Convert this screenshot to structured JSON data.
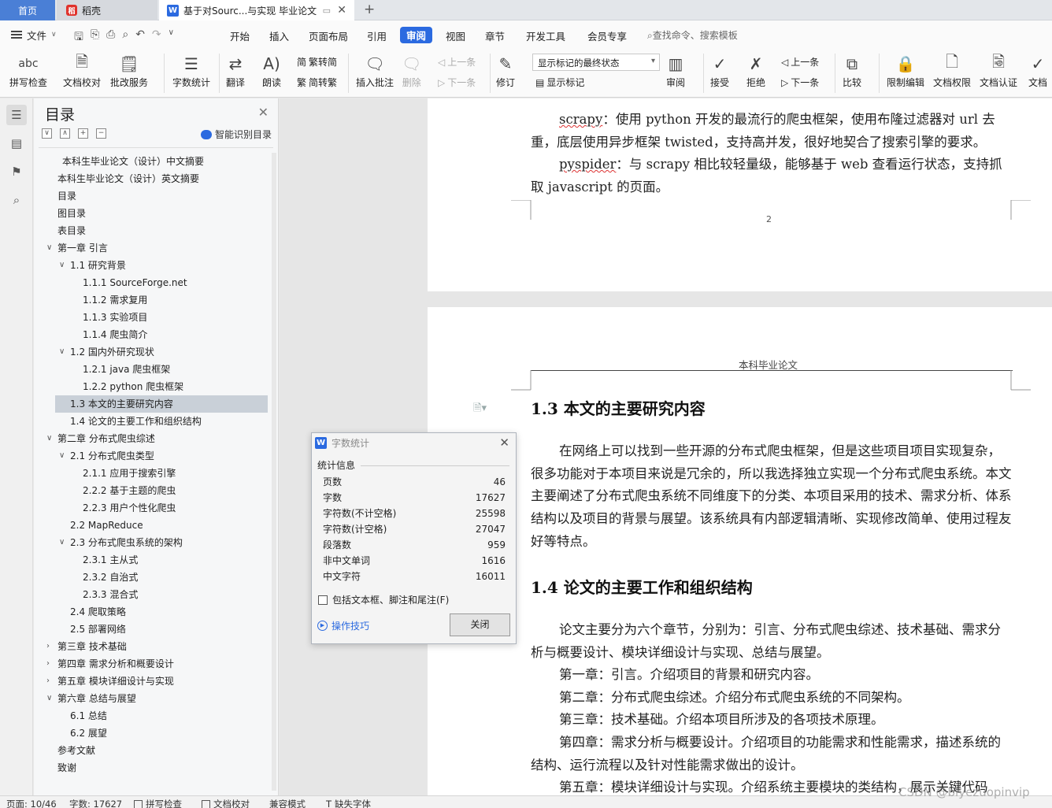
{
  "tabs": {
    "home": "首页",
    "daoke": "稻壳",
    "doc": "基于对Sourc...与实现 毕业论文"
  },
  "menu": {
    "file": "文件",
    "items": [
      "开始",
      "插入",
      "页面布局",
      "引用",
      "审阅",
      "视图",
      "章节",
      "开发工具",
      "会员专享"
    ],
    "active": "审阅",
    "search": "查找命令、搜索模板"
  },
  "toolbar": {
    "spell": "拼写检查",
    "doc_check": "文档校对",
    "batch": "批改服务",
    "word_count": "字数统计",
    "translate": "翻译",
    "read_aloud": "朗读",
    "trad": "繁转简",
    "simp": "简转繁",
    "insert_comment": "插入批注",
    "delete": "删除",
    "prev": "上一条",
    "next": "下一条",
    "revise": "修订",
    "markup_select": "显示标记的最终状态",
    "show_markup": "显示标记",
    "review": "审阅",
    "accept": "接受",
    "reject": "拒绝",
    "prev2": "上一条",
    "next2": "下一条",
    "compare": "比较",
    "restrict": "限制编辑",
    "permission": "文档权限",
    "auth": "文档认证",
    "more": "文档"
  },
  "toc": {
    "title": "目录",
    "smart": "智能识别目录",
    "items": [
      {
        "text": "本科生毕业论文（设计）中文摘要",
        "level": 0
      },
      {
        "text": "本科生毕业论文（设计）英文摘要",
        "level": 0
      },
      {
        "text": "目录",
        "level": 0
      },
      {
        "text": "图目录",
        "level": 0
      },
      {
        "text": "表目录",
        "level": 0
      },
      {
        "text": "第一章  引言",
        "level": 0,
        "arrow": "v"
      },
      {
        "text": "1.1  研究背景",
        "level": 1,
        "arrow": "v"
      },
      {
        "text": "1.1.1 SourceForge.net",
        "level": 2
      },
      {
        "text": "1.1.2  需求复用",
        "level": 2
      },
      {
        "text": "1.1.3  实验项目",
        "level": 2
      },
      {
        "text": "1.1.4  爬虫简介",
        "level": 2
      },
      {
        "text": "1.2  国内外研究现状",
        "level": 1,
        "arrow": "v"
      },
      {
        "text": "1.2.1 java 爬虫框架",
        "level": 2
      },
      {
        "text": "1.2.2 python 爬虫框架",
        "level": 2
      },
      {
        "text": "1.3  本文的主要研究内容",
        "level": 1,
        "selected": true
      },
      {
        "text": "1.4  论文的主要工作和组织结构",
        "level": 1
      },
      {
        "text": "第二章  分布式爬虫综述",
        "level": 0,
        "arrow": "v"
      },
      {
        "text": "2.1  分布式爬虫类型",
        "level": 1,
        "arrow": "v"
      },
      {
        "text": "2.1.1  应用于搜索引擎",
        "level": 2
      },
      {
        "text": "2.2.2  基于主题的爬虫",
        "level": 2
      },
      {
        "text": "2.2.3  用户个性化爬虫",
        "level": 2
      },
      {
        "text": "2.2 MapReduce",
        "level": 1
      },
      {
        "text": "2.3  分布式爬虫系统的架构",
        "level": 1,
        "arrow": "v"
      },
      {
        "text": "2.3.1  主从式",
        "level": 2
      },
      {
        "text": "2.3.2  自治式",
        "level": 2
      },
      {
        "text": "2.3.3  混合式",
        "level": 2
      },
      {
        "text": "2.4  爬取策略",
        "level": 1
      },
      {
        "text": "2.5  部署网络",
        "level": 1
      },
      {
        "text": "第三章  技术基础",
        "level": 0,
        "arrow": ">"
      },
      {
        "text": "第四章  需求分析和概要设计",
        "level": 0,
        "arrow": ">"
      },
      {
        "text": "第五章  模块详细设计与实现",
        "level": 0,
        "arrow": ">"
      },
      {
        "text": "第六章  总结与展望",
        "level": 0,
        "arrow": "v"
      },
      {
        "text": "6.1  总结",
        "level": 1
      },
      {
        "text": "6.2  展望",
        "level": 1
      },
      {
        "text": "参考文献",
        "level": 0
      },
      {
        "text": "致谢",
        "level": 0
      }
    ]
  },
  "doc": {
    "p1_term": "scrapy",
    "p1_rest": "：使用 python 开发的最流行的爬虫框架，使用布隆过滤器对 url 去重，底层使用异步框架 twisted，支持高并发，很好地契合了搜索引擎的要求。",
    "p2_term": "pyspider",
    "p2_rest": "：与 scrapy 相比较轻量级，能够基于 web 查看运行状态，支持抓取 javascript 的页面。",
    "page_number": "2",
    "header": "本科毕业论文",
    "h13": "1.3  本文的主要研究内容",
    "p3": "在网络上可以找到一些开源的分布式爬虫框架，但是这些项目项目实现复杂，很多功能对于本项目来说是冗余的，所以我选择独立实现一个分布式爬虫系统。本文主要阐述了分布式爬虫系统不同维度下的分类、本项目采用的技术、需求分析、体系结构以及项目的背景与展望。该系统具有内部逻辑清晰、实现修改简单、使用过程友好等特点。",
    "h14": "1.4  论文的主要工作和组织结构",
    "p4": "论文主要分为六个章节，分别为：引言、分布式爬虫综述、技术基础、需求分析与概要设计、模块详细设计与实现、总结与展望。",
    "c1": "第一章：引言。介绍项目的背景和研究内容。",
    "c2": "第二章：分布式爬虫综述。介绍分布式爬虫系统的不同架构。",
    "c3": "第三章：技术基础。介绍本项目所涉及的各项技术原理。",
    "c4": "第四章：需求分析与概要设计。介绍项目的功能需求和性能需求，描述系统的结构、运行流程以及针对性能需求做出的设计。",
    "c5": "第五章：模块详细设计与实现。介绍系统主要模块的类结构，展示关键代码"
  },
  "dialog": {
    "title": "字数统计",
    "section": "统计信息",
    "rows": [
      {
        "label": "页数",
        "value": "46"
      },
      {
        "label": "字数",
        "value": "17627"
      },
      {
        "label": "字符数(不计空格)",
        "value": "25598"
      },
      {
        "label": "字符数(计空格)",
        "value": "27047"
      },
      {
        "label": "段落数",
        "value": "959"
      },
      {
        "label": "非中文单词",
        "value": "1616"
      },
      {
        "label": "中文字符",
        "value": "16011"
      }
    ],
    "include": "包括文本框、脚注和尾注(F)",
    "tips": "操作技巧",
    "close": "关闭"
  },
  "status": {
    "page": "页面: 10/46",
    "words": "字数: 17627",
    "spell": "拼写检查",
    "doc_check": "文档校对",
    "compat": "兼容模式",
    "missing_font": "缺失字体"
  },
  "watermark": "CSDN @biyezuopinvip",
  "colors": {
    "accent": "#2b6ae0",
    "home_tab": "#4a7fd6",
    "selected_toc": "#c9d0d8"
  }
}
